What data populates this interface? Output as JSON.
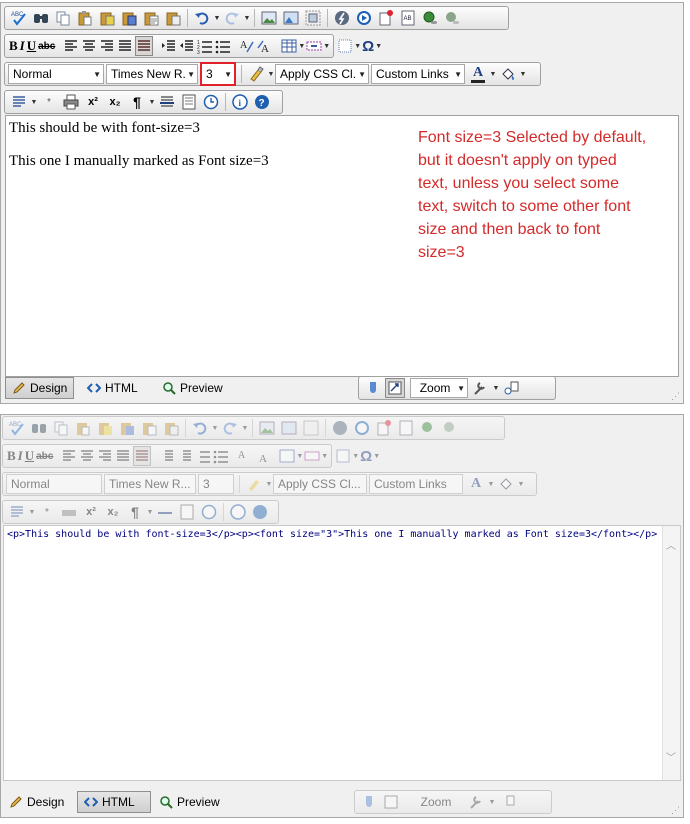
{
  "top": {
    "toolbar1_icons": [
      "spellcheck-icon",
      "find-icon",
      "copy-icon",
      "paste-icon",
      "paste-text-icon",
      "paste-word-icon",
      "paste-html-icon",
      "paste-plain-icon",
      "undo-icon",
      "redo-icon",
      "image-manager-icon",
      "image-map-icon",
      "insert-image-icon",
      "flash-manager-icon",
      "media-manager-icon",
      "document-manager-icon",
      "template-manager-icon",
      "hyperlink-icon",
      "remove-link-icon"
    ],
    "toolbar2": {
      "bold": "B",
      "italic": "I",
      "underline": "U",
      "strike": "abc",
      "special_char": "Ω"
    },
    "format_block": "Normal",
    "font_name": "Times New R...",
    "font_size": "3",
    "css_class": "Apply CSS Cl...",
    "custom_links": "Custom Links",
    "font_color_letter": "A",
    "superscript": "x²",
    "subscript": "x₂",
    "paragraph_mark": "¶",
    "content": {
      "line1": "This should be with font-size=3",
      "line2": "This one I manually marked as Font size=3"
    },
    "note": "Font size=3 Selected by default, but it doesn't apply on typed text, unless you select some text, switch to some other font size and then back to font size=3",
    "tabs": {
      "design": "Design",
      "html": "HTML",
      "preview": "Preview"
    },
    "zoom": "Zoom",
    "highlight_color": "#e0202a"
  },
  "bottom": {
    "format_block": "Normal",
    "font_name": "Times New R...",
    "font_size": "3",
    "css_class": "Apply CSS Cl...",
    "custom_links": "Custom Links",
    "html_source": "<p>This should be with font-size=3</p><p><font size=\"3\">This one I manually marked as Font size=3</font></p>",
    "tabs": {
      "design": "Design",
      "html": "HTML",
      "preview": "Preview"
    },
    "zoom": "Zoom"
  },
  "colors": {
    "note_red": "#d42a2a",
    "code_blue": "#000080",
    "panel_bg": "#f0f0f0"
  }
}
